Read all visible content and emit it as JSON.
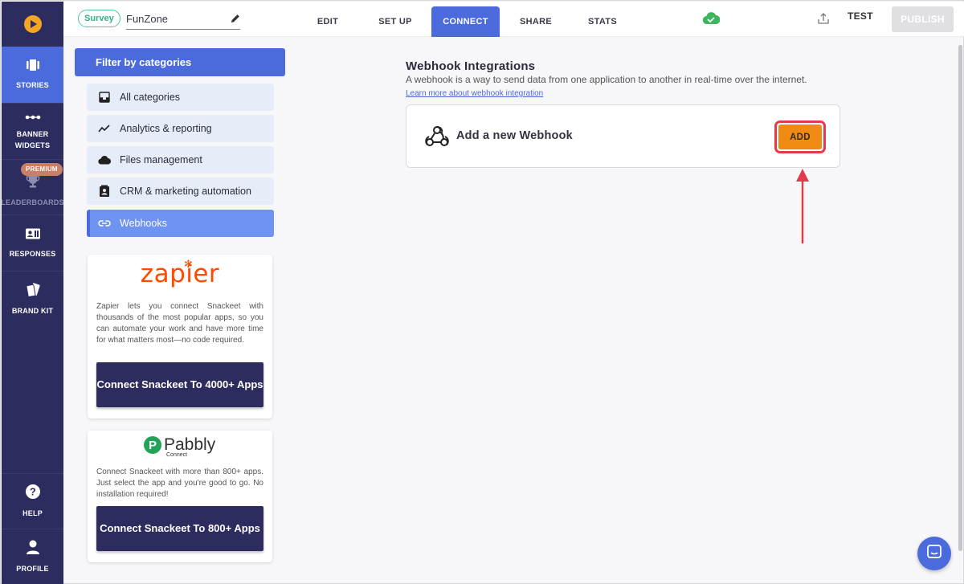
{
  "sidebar": {
    "items": [
      {
        "label": "STORIES",
        "icon": "stories-icon"
      },
      {
        "label": "BANNER WIDGETS",
        "icon": "banner-widgets-icon"
      },
      {
        "label": "LEADERBOARDS",
        "icon": "trophy-icon",
        "badge": "PREMIUM"
      },
      {
        "label": "RESPONSES",
        "icon": "responses-icon"
      },
      {
        "label": "BRAND KIT",
        "icon": "brand-kit-icon"
      }
    ],
    "help": "HELP",
    "profile": "PROFILE"
  },
  "topbar": {
    "type_badge": "Survey",
    "story_name": "FunZone",
    "tabs": [
      "EDIT",
      "SET UP",
      "CONNECT",
      "SHARE",
      "STATS"
    ],
    "active_tab": "CONNECT",
    "test_label": "TEST",
    "publish_label": "PUBLISH"
  },
  "filter": {
    "heading": "Filter by categories",
    "categories": [
      {
        "label": "All categories",
        "icon": "inbox-icon"
      },
      {
        "label": "Analytics & reporting",
        "icon": "trend-icon"
      },
      {
        "label": "Files management",
        "icon": "cloud-icon"
      },
      {
        "label": "CRM & marketing automation",
        "icon": "contact-icon"
      },
      {
        "label": "Webhooks",
        "icon": "link-icon"
      }
    ],
    "active": "Webhooks"
  },
  "zapier": {
    "logo": "zapier",
    "description": "Zapier lets you connect Snackeet with thousands of the most popular apps, so you can automate your work and have more time for what matters most—no code required.",
    "button": "Connect Snackeet To 4000+ Apps"
  },
  "pabbly": {
    "logo": "Pabbly",
    "logo_sub": "Connect",
    "description": "Connect Snackeet with more than 800+ apps. Just select the app and you're good to go. No installation required!",
    "button": "Connect Snackeet To 800+ Apps"
  },
  "webhooks": {
    "title": "Webhook Integrations",
    "description": "A webhook is a way to send data from one application to another in real-time over the internet.",
    "learn_more": "Learn more about webhook integration",
    "add_label": "Add a new Webhook",
    "add_button": "ADD"
  },
  "colors": {
    "sidebar": "#2d2c5e",
    "accent": "#4b6bdc",
    "add_button": "#ef8b12",
    "annotation": "#e23b4f"
  }
}
